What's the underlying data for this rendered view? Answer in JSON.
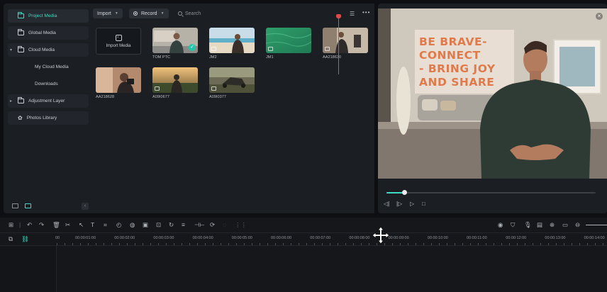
{
  "sidebar": {
    "items": [
      {
        "label": "Project Media",
        "active": true
      },
      {
        "label": "Global Media"
      },
      {
        "label": "Cloud Media",
        "expanded": true
      },
      {
        "label": "My Cloud Media",
        "sub": true
      },
      {
        "label": "Downloads",
        "sub": true
      },
      {
        "label": "Adjustment Layer"
      },
      {
        "label": "Photos Library"
      }
    ]
  },
  "media_toolbar": {
    "import_label": "Import",
    "record_label": "Record",
    "search_placeholder": "Search",
    "icons": [
      "filter-sort-icon",
      "more-options-icon"
    ]
  },
  "media_items": [
    {
      "label": "Import Media",
      "type": "import"
    },
    {
      "label": "TOM PTC",
      "selected": true
    },
    {
      "label": "JM2"
    },
    {
      "label": "JM1"
    },
    {
      "label": "AA218630"
    },
    {
      "label": "AA218628"
    },
    {
      "label": "A09I0677"
    },
    {
      "label": "A09I0377"
    }
  ],
  "preview": {
    "sign_lines": [
      "BE BRAVE-",
      "CONNECT",
      "- BRING JOY",
      "AND SHARE"
    ],
    "progress": 0.085,
    "controls": [
      "prev-frame-icon",
      "play-icon",
      "next-icon",
      "stop-icon"
    ]
  },
  "timeline": {
    "ruler_labels": [
      "00",
      "00:00:01:00",
      "00:00:02:00",
      "00:00:03:00",
      "00:00:04:00",
      "00:00:05:00",
      "00:00:06:00",
      "00:00:07:00",
      "00:00:08:00",
      "00:00:09:00",
      "00:00:10:00",
      "00:00:11:00",
      "00:00:12:00",
      "00:00:13:00",
      "00:00:14:00"
    ]
  },
  "colors": {
    "accent": "#3ddbc2",
    "playhead": "#e04a4a",
    "panel": "#1b1e23",
    "background": "#0d0f12"
  }
}
